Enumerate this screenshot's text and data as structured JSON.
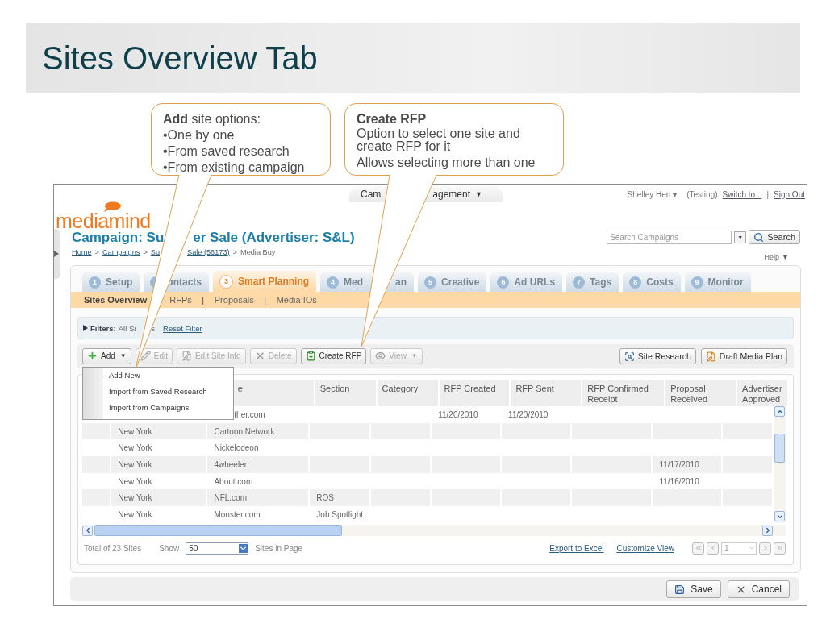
{
  "slide_title": "Sites Overview Tab",
  "callouts": [
    {
      "kind": "bullets",
      "heading": "**Add** site options:",
      "lines": [
        "•One by one",
        "•From saved research",
        "•From existing campaign"
      ]
    },
    {
      "kind": "notes",
      "title": "Create RFP",
      "lines": [
        "Option to select one site and create RFP for it",
        "Allows selecting more than one"
      ]
    }
  ],
  "app": {
    "top_menu": {
      "parts": [
        "Cam",
        "agement"
      ],
      "caret": "▼"
    },
    "user": {
      "name": "Shelley Hen",
      "caret": "▾",
      "mode": "(Testing)",
      "switch_link": "Switch to...",
      "separator": "|",
      "sign_out": "Sign Out"
    },
    "logo": "mediamind",
    "campaign_title": [
      "Campaign: Su",
      "er Sale (Advertiser: S&L)"
    ],
    "breadcrumb": {
      "separator": ">",
      "items": [
        {
          "parts": [
            "Home"
          ],
          "link": true
        },
        {
          "parts": [
            "Campaigns"
          ],
          "link": true
        },
        {
          "parts": [
            "Su",
            "Sale (56173)"
          ],
          "link": true
        },
        {
          "parts": [
            "Media Buy"
          ],
          "link": false
        }
      ]
    },
    "search": {
      "placeholder": "Search Campaigns",
      "caret": "▼",
      "button": "Search"
    },
    "help": {
      "label": "Help",
      "caret": "▼"
    },
    "tabs": [
      {
        "number": "1",
        "label": [
          "Setup"
        ],
        "selected": false
      },
      {
        "label": [
          "ontacts"
        ],
        "selected": false
      },
      {
        "number": "3",
        "label": [
          "Smart Planning"
        ],
        "selected": true
      },
      {
        "number": "4",
        "label": [
          "Med",
          "an"
        ],
        "selected": false
      },
      {
        "number": "5",
        "label": [
          "Creative"
        ],
        "selected": false
      },
      {
        "number": "6",
        "label": [
          "Ad URLs"
        ],
        "selected": false
      },
      {
        "number": "7",
        "label": [
          "Tags"
        ],
        "selected": false
      },
      {
        "number": "8",
        "label": [
          "Costs"
        ],
        "selected": false
      },
      {
        "number": "9",
        "label": [
          "Monitor"
        ],
        "selected": false
      }
    ],
    "subnav": [
      {
        "label": "Sites Overview",
        "selected": true
      },
      {
        "label": "RFPs",
        "selected": false
      },
      {
        "label": "Proposals",
        "selected": false,
        "separator": "|"
      },
      {
        "label": "Media IOs",
        "selected": false,
        "separator": "|"
      }
    ],
    "filters": {
      "label": "Filters:",
      "value": [
        "All Si",
        "s"
      ],
      "reset": "Reset Filter"
    },
    "toolbar": [
      {
        "label": "Add",
        "kind": "add",
        "disabled": false,
        "caret": "▼"
      },
      {
        "label": "Edit",
        "kind": "edit",
        "disabled": true
      },
      {
        "label": "Edit Site Info",
        "kind": "info",
        "disabled": true
      },
      {
        "label": "Delete",
        "kind": "delete",
        "disabled": true
      },
      {
        "label": "Create RFP",
        "kind": "rfp",
        "disabled": false
      },
      {
        "label": "View",
        "kind": "view",
        "disabled": true,
        "caret": "▼"
      }
    ],
    "toolbar_right": [
      {
        "label": "Site Research",
        "kind": "research"
      },
      {
        "label": "Draft Media Plan",
        "kind": "draft"
      }
    ],
    "add_menu": [
      "Add New",
      "Import from Saved Research",
      "Import from Campaigns"
    ],
    "table": {
      "columns": [
        "e",
        "Section",
        "Category",
        "RFP Created",
        "RFP Sent",
        "RFP Confirmed Receipt",
        "Proposal Received",
        "Advertiser Approved"
      ],
      "rows": [
        {
          "site": "ther.com",
          "rfp_created": "11/20/2010",
          "rfp_sent": "11/20/2010"
        },
        {
          "city": "New York",
          "site": "Cartoon Network"
        },
        {
          "city": "New York",
          "site": "Nickelodeon"
        },
        {
          "city": "New York",
          "site": "4wheeler",
          "proposal_received": "11/17/2010"
        },
        {
          "city": "New York",
          "site": "About.com",
          "proposal_received": "11/16/2010"
        },
        {
          "city": "New York",
          "site": "NFL.com",
          "section": "ROS"
        },
        {
          "city": "New York",
          "site": "Monster.com",
          "section": "Job Spotlight"
        }
      ]
    },
    "footer": {
      "total": "Total of 23 Sites",
      "show": "Show",
      "page_size": "50",
      "page_size_suffix": "Sites in Page",
      "export": "Export to Excel",
      "customize": "Customize View",
      "page": "1"
    },
    "actions": [
      {
        "label": "Save",
        "kind": "save"
      },
      {
        "label": "Cancel",
        "kind": "cancel"
      }
    ]
  }
}
